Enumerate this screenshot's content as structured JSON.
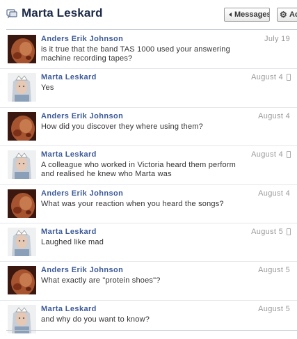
{
  "header": {
    "title": "Marta Leskard",
    "messages_button": "Messages",
    "actions_button": "Ac"
  },
  "messages": [
    {
      "sender": "Anders Erik Johnson",
      "date": "July 19",
      "mobile": false,
      "avatar": "anders-avatar",
      "body": "is it true that the band TAS 1000 used your answering machine recording tapes?"
    },
    {
      "sender": "Marta Leskard",
      "date": "August 4",
      "mobile": true,
      "avatar": "marta-avatar",
      "body": "Yes"
    },
    {
      "sender": "Anders Erik Johnson",
      "date": "August 4",
      "mobile": false,
      "avatar": "anders-avatar",
      "body": "How did you discover they where using them?"
    },
    {
      "sender": "Marta Leskard",
      "date": "August 4",
      "mobile": true,
      "avatar": "marta-avatar",
      "body": "A colleague who worked in Victoria heard them perform and realised he knew who Marta was"
    },
    {
      "sender": "Anders Erik Johnson",
      "date": "August 4",
      "mobile": false,
      "avatar": "anders-avatar",
      "body": "What was your reaction when you heard the songs?"
    },
    {
      "sender": "Marta Leskard",
      "date": "August 5",
      "mobile": true,
      "avatar": "marta-avatar",
      "body": "Laughed like mad"
    },
    {
      "sender": "Anders Erik Johnson",
      "date": "August 5",
      "mobile": false,
      "avatar": "anders-avatar",
      "body": "What exactly are \"protein shoes\"?"
    },
    {
      "sender": "Marta Leskard",
      "date": "August 5",
      "mobile": false,
      "avatar": "marta-avatar",
      "body": "and why do you want to know?"
    }
  ],
  "colors": {
    "title": "#1c2a47",
    "sender_link": "#3b5998",
    "date": "#999999",
    "body_text": "#333333",
    "divider": "#e4e6eb"
  },
  "icons": {
    "title": "messages-icon",
    "back": "left-arrow-icon",
    "actions": "gear-icon",
    "mobile": "mobile-phone-icon"
  }
}
